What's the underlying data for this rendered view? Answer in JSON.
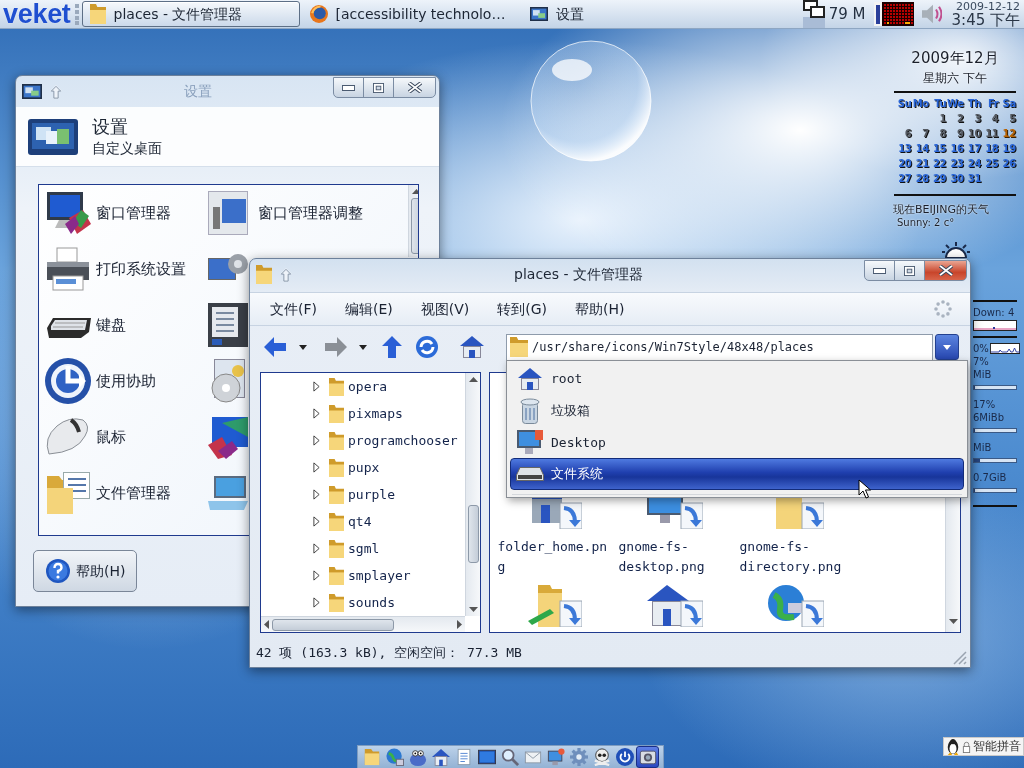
{
  "top_panel": {
    "logo": "veket",
    "tasks": [
      {
        "label": "places - 文件管理器",
        "selected": true
      },
      {
        "label": "[accessibility technolo…",
        "selected": false
      },
      {
        "label": "设置",
        "selected": false
      }
    ],
    "memory": "79 M",
    "date": "2009-12-12",
    "time": "3:45 下午"
  },
  "calendar": {
    "month": "2009年12月",
    "weekday": "星期六 下午",
    "weekdays": [
      "Su",
      "Mo",
      "Tu",
      "We",
      "Th",
      "Fr",
      "Sa"
    ],
    "weeks": [
      [
        {
          "day": "1",
          "kind": "past"
        },
        {
          "day": "2",
          "kind": "past"
        },
        {
          "day": "3",
          "kind": "past"
        },
        {
          "day": "4",
          "kind": "past"
        },
        {
          "day": "5",
          "kind": "past"
        }
      ],
      [
        {
          "day": "6",
          "kind": "past"
        },
        {
          "day": "7",
          "kind": "past"
        },
        {
          "day": "8",
          "kind": "past"
        },
        {
          "day": "9",
          "kind": "past"
        },
        {
          "day": "10",
          "kind": "past"
        },
        {
          "day": "11",
          "kind": "past"
        },
        {
          "day": "12",
          "kind": "today"
        }
      ],
      [
        {
          "day": "13",
          "kind": "future"
        },
        {
          "day": "14",
          "kind": "future"
        },
        {
          "day": "15",
          "kind": "future"
        },
        {
          "day": "16",
          "kind": "future"
        },
        {
          "day": "17",
          "kind": "future"
        },
        {
          "day": "18",
          "kind": "future"
        },
        {
          "day": "19",
          "kind": "future"
        }
      ],
      [
        {
          "day": "20",
          "kind": "future"
        },
        {
          "day": "21",
          "kind": "future"
        },
        {
          "day": "22",
          "kind": "future"
        },
        {
          "day": "23",
          "kind": "future"
        },
        {
          "day": "24",
          "kind": "future"
        },
        {
          "day": "25",
          "kind": "future"
        },
        {
          "day": "26",
          "kind": "future"
        }
      ],
      [
        {
          "day": "27",
          "kind": "future"
        },
        {
          "day": "28",
          "kind": "future"
        },
        {
          "day": "29",
          "kind": "future"
        },
        {
          "day": "30",
          "kind": "future"
        },
        {
          "day": "31",
          "kind": "future"
        }
      ]
    ],
    "weather_title": "现在BEIJING的天气",
    "weather": "Sunny: 2 c°"
  },
  "system_monitor": [
    {
      "kind": "rule"
    },
    {
      "kind": "text",
      "text": "Down: 4"
    },
    {
      "kind": "graph"
    },
    {
      "kind": "rule"
    },
    {
      "kind": "graph_text",
      "text": "0%"
    },
    {
      "kind": "text",
      "text": "7%"
    },
    {
      "kind": "text",
      "text": "MiB"
    },
    {
      "kind": "bar",
      "level": 0.03
    },
    {
      "kind": "text",
      "text": "17%"
    },
    {
      "kind": "text",
      "text": "6MiBb"
    },
    {
      "kind": "bar",
      "level": 0.03
    },
    {
      "kind": "text",
      "text": "MiB"
    },
    {
      "kind": "bar",
      "level": 0.15
    },
    {
      "kind": "text",
      "text": "0.7GiB"
    },
    {
      "kind": "bar",
      "level": 0.03
    },
    {
      "kind": "rule"
    }
  ],
  "settings_window": {
    "title": "设置",
    "active": false,
    "header_title": "设置",
    "header_subtitle": "自定义桌面",
    "items": [
      {
        "kind": "labeled",
        "label": "窗口管理器"
      },
      {
        "kind": "labeled",
        "label": "窗口管理器调整"
      },
      {
        "kind": "labeled",
        "label": "打印系统设置"
      },
      {
        "kind": "icon_only"
      },
      {
        "kind": "labeled",
        "label": "键盘"
      },
      {
        "kind": "icon_only"
      },
      {
        "kind": "labeled",
        "label": "使用协助"
      },
      {
        "kind": "icon_only"
      },
      {
        "kind": "labeled",
        "label": "鼠标"
      },
      {
        "kind": "icon_only"
      },
      {
        "kind": "labeled",
        "label": "文件管理器"
      },
      {
        "kind": "icon_only"
      }
    ],
    "help_button": "帮助(H)"
  },
  "file_manager": {
    "title": "places - 文件管理器",
    "active": true,
    "menu": [
      "文件(F)",
      "编辑(E)",
      "视图(V)",
      "转到(G)",
      "帮助(H)"
    ],
    "location": "/usr/share/icons/Win7Style/48x48/places",
    "tree": [
      {
        "label": "opera",
        "expanded": false
      },
      {
        "label": "pixmaps",
        "expanded": false
      },
      {
        "label": "programchooser",
        "expanded": false
      },
      {
        "label": "pupx",
        "expanded": false
      },
      {
        "label": "purple",
        "expanded": false
      },
      {
        "label": "qt4",
        "expanded": false
      },
      {
        "label": "sgml",
        "expanded": false
      },
      {
        "label": "smplayer",
        "expanded": false
      },
      {
        "label": "sounds",
        "expanded": false
      }
    ],
    "files": [
      {
        "kind": "labeled",
        "name": "folder_home.png"
      },
      {
        "kind": "labeled",
        "name": "gnome-fs-desktop.png"
      },
      {
        "kind": "labeled",
        "name": "gnome-fs-directory.png"
      },
      {
        "kind": "icon_only"
      },
      {
        "kind": "icon_only"
      },
      {
        "kind": "icon_only"
      }
    ],
    "status": "42 项 (163.3 kB), 空闲空间： 77.3 MB"
  },
  "location_dropdown": [
    {
      "label": "root",
      "selected": false
    },
    {
      "label": "垃圾箱",
      "selected": false
    },
    {
      "label": "Desktop",
      "selected": false
    },
    {
      "label": "文件系统",
      "selected": true
    }
  ],
  "dock": [
    {
      "selected": false
    },
    {
      "selected": false
    },
    {
      "selected": false
    },
    {
      "selected": false
    },
    {
      "selected": false
    },
    {
      "selected": false
    },
    {
      "selected": false
    },
    {
      "selected": false
    },
    {
      "selected": false
    },
    {
      "selected": false
    },
    {
      "selected": false
    },
    {
      "selected": false
    },
    {
      "selected": true
    }
  ],
  "tray": {
    "input_method": "智能拼音"
  }
}
